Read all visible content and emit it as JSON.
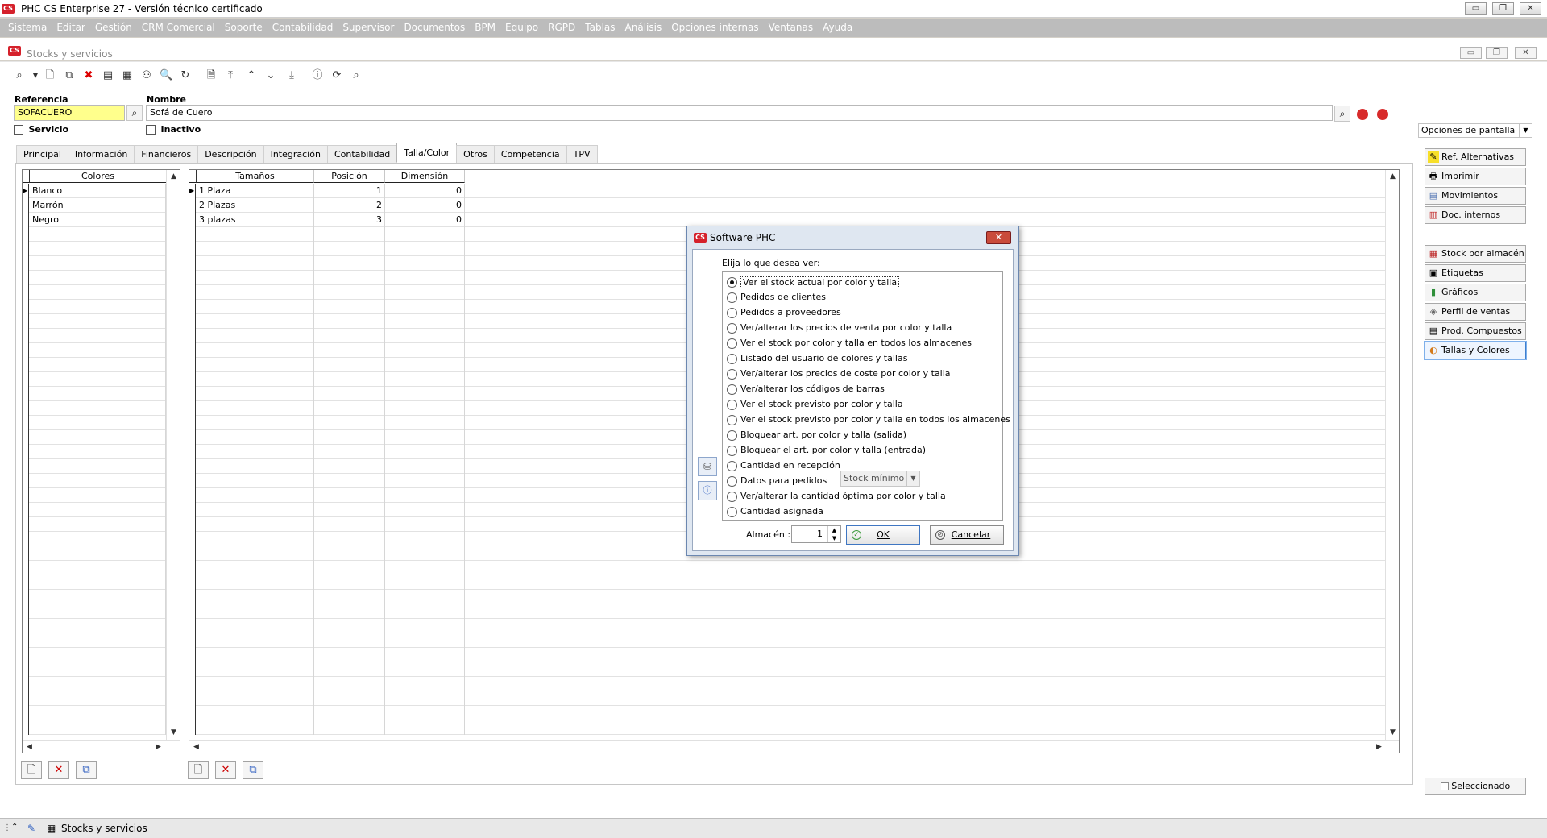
{
  "window": {
    "title": "PHC CS Enterprise 27 - Versión técnico certificado",
    "logo": "CS",
    "buttons": [
      "▭",
      "❐",
      "✕"
    ]
  },
  "menu": [
    "Sistema",
    "Editar",
    "Gestión",
    "CRM Comercial",
    "Soporte",
    "Contabilidad",
    "Supervisor",
    "Documentos",
    "BPM",
    "Equipo",
    "RGPD",
    "Tablas",
    "Análisis",
    "Opciones internas",
    "Ventanas",
    "Ayuda"
  ],
  "child_window": {
    "title": "Stocks y servicios"
  },
  "form": {
    "referencia_label": "Referencia",
    "referencia_value": "SOFACUERO",
    "nombre_label": "Nombre",
    "nombre_value": "Sofá de Cuero",
    "servicio_label": "Servicio",
    "inactivo_label": "Inactivo"
  },
  "tabs": [
    "Principal",
    "Información",
    "Financieros",
    "Descripción",
    "Integración",
    "Contabilidad",
    "Talla/Color",
    "Otros",
    "Competencia",
    "TPV"
  ],
  "active_tab": "Talla/Color",
  "colores_grid": {
    "header": "Colores",
    "rows": [
      "Blanco",
      "Marrón",
      "Negro"
    ]
  },
  "tallas_grid": {
    "headers": [
      "Tamaños",
      "Posición",
      "Dimensión"
    ],
    "rows": [
      {
        "tamano": "1 Plaza",
        "posicion": "1",
        "dimension": "0"
      },
      {
        "tamano": "2 Plazas",
        "posicion": "2",
        "dimension": "0"
      },
      {
        "tamano": "3 plazas",
        "posicion": "3",
        "dimension": "0"
      }
    ]
  },
  "right_panel": {
    "header": "Opciones de pantalla",
    "buttons_top": [
      "Ref. Alternativas",
      "Imprimir",
      "Movimientos",
      "Doc. internos"
    ],
    "buttons_bottom": [
      "Stock por almacén",
      "Etiquetas",
      "Gráficos",
      "Perfil de ventas",
      "Prod. Compuestos",
      "Tallas y Colores"
    ],
    "selected_button": "Tallas y Colores",
    "seleccionado_label": "Seleccionado"
  },
  "statusbar": {
    "item": "Stocks y servicios"
  },
  "dialog": {
    "title": "Software PHC",
    "prompt": "Elija lo que desea ver:",
    "options": [
      "Ver el stock actual por color y talla",
      "Pedidos de clientes",
      "Pedidos a proveedores",
      "Ver/alterar los precios de venta por color y talla",
      "Ver el stock por color y talla en todos los almacenes",
      "Listado del usuario de colores y tallas",
      "Ver/alterar los precios de coste por color y talla",
      "Ver/alterar los códigos de barras",
      "Ver el stock previsto por color y talla",
      "Ver el stock previsto por color y talla en todos los almacenes",
      "Bloquear art. por color y talla (salida)",
      "Bloquear el art. por color y talla (entrada)",
      "Cantidad en recepción",
      "Datos para pedidos",
      "Ver/alterar la cantidad óptima por color y talla",
      "Cantidad asignada"
    ],
    "selected_option": 0,
    "stock_select_value": "Stock mínimo",
    "almacen_label": "Almacén :",
    "almacen_value": "1",
    "ok_label": "OK",
    "cancel_label": "Cancelar"
  }
}
